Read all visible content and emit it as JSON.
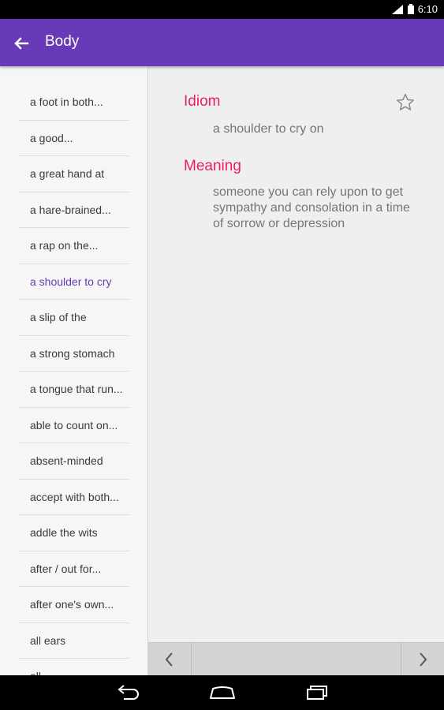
{
  "status_bar": {
    "time": "6:10"
  },
  "app_bar": {
    "title": "Body",
    "back_icon": "arrow-back-icon"
  },
  "idioms": [
    "a foot in both...",
    "a good...",
    "a great hand at",
    "a hare-brained...",
    "a rap on the...",
    "a shoulder to cry",
    "a slip of the",
    "a strong stomach",
    "a tongue that run...",
    "able to count on...",
    "absent-minded",
    "accept with both...",
    "addle the wits",
    "after / out for...",
    "after one's own...",
    "all ears",
    "all..."
  ],
  "selected_index": 5,
  "detail": {
    "idiom_label": "Idiom",
    "idiom_text": "a shoulder to cry on",
    "meaning_label": "Meaning",
    "meaning_text": "someone you can rely upon to get sympathy and consolation in a time of sorrow or depression",
    "favorite_icon": "star-outline-icon"
  },
  "colors": {
    "primary": "#673AB7",
    "accent": "#E91E63",
    "selected_text": "#673AB7"
  }
}
